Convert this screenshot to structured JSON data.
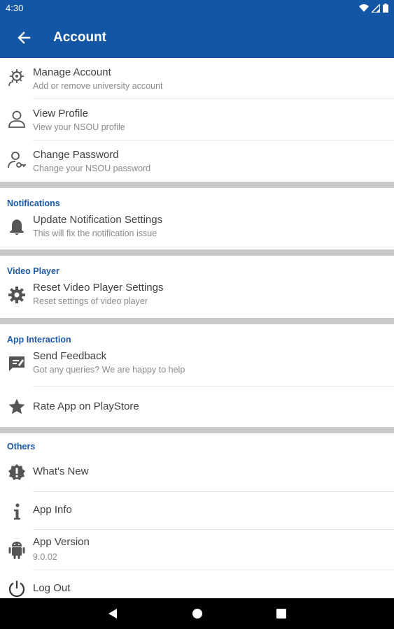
{
  "status_bar": {
    "time": "4:30",
    "icons": [
      "wifi-icon",
      "signal-icon",
      "battery-icon"
    ]
  },
  "app_bar": {
    "title": "Account",
    "back_icon": "arrow-left-icon"
  },
  "account_items": [
    {
      "title": "Manage Account",
      "subtitle": "Add or remove university account",
      "icon": "manage-account-icon"
    },
    {
      "title": "View Profile",
      "subtitle": "View your NSOU profile",
      "icon": "person-icon"
    },
    {
      "title": "Change Password",
      "subtitle": "Change your NSOU password",
      "icon": "person-key-icon"
    }
  ],
  "notifications": {
    "header": "Notifications",
    "items": [
      {
        "title": "Update Notification Settings",
        "subtitle": "This will fix the notification issue",
        "icon": "bell-icon"
      }
    ]
  },
  "video_player": {
    "header": "Video Player",
    "items": [
      {
        "title": "Reset Video Player Settings",
        "subtitle": "Reset settings of video player",
        "icon": "gear-icon"
      }
    ]
  },
  "app_interaction": {
    "header": "App Interaction",
    "items": [
      {
        "title": "Send Feedback",
        "subtitle": "Got any queries? We are happy to help",
        "icon": "feedback-icon"
      },
      {
        "title": "Rate App on PlayStore",
        "icon": "star-icon"
      }
    ]
  },
  "others": {
    "header": "Others",
    "items": [
      {
        "title": "What's New",
        "icon": "badge-alert-icon"
      },
      {
        "title": "App Info",
        "icon": "info-icon"
      },
      {
        "title": "App Version",
        "subtitle": "9.0.02",
        "icon": "android-icon"
      },
      {
        "title": "Log Out",
        "icon": "power-icon"
      }
    ]
  },
  "colors": {
    "primary": "#1356a5",
    "section_header": "#1c5aa8",
    "divider_band": "#c9c9c9"
  }
}
